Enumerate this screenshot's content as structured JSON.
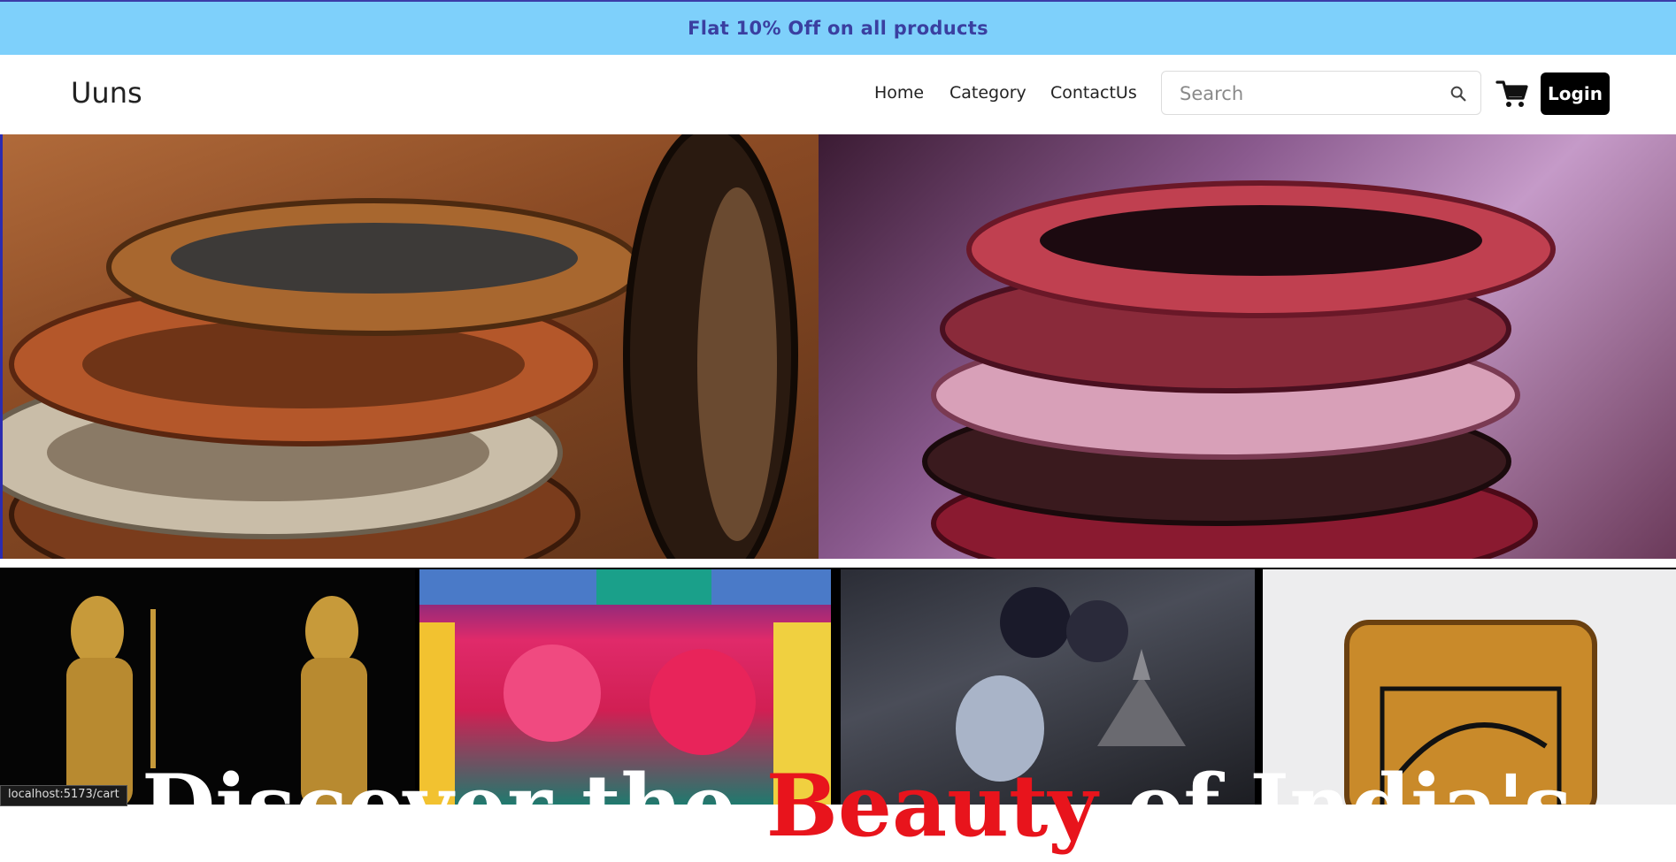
{
  "promo": {
    "text": "Flat 10% Off on all products"
  },
  "nav": {
    "brand": "Uuns",
    "links": [
      {
        "label": "Home"
      },
      {
        "label": "Category"
      },
      {
        "label": "ContactUs"
      }
    ],
    "search_placeholder": "Search",
    "login_label": "Login"
  },
  "hero": {
    "line_before": "Discover the ",
    "highlight": "Beauty",
    "line_after": " of India's"
  },
  "status_bar": {
    "url": "localhost:5173/cart"
  },
  "colors": {
    "promo_bg": "#7ed0fb",
    "promo_text": "#3a3fa0",
    "login_bg": "#000000",
    "hero_highlight": "#e8141c"
  },
  "icons": {
    "search": "search-icon",
    "cart": "cart-icon"
  }
}
